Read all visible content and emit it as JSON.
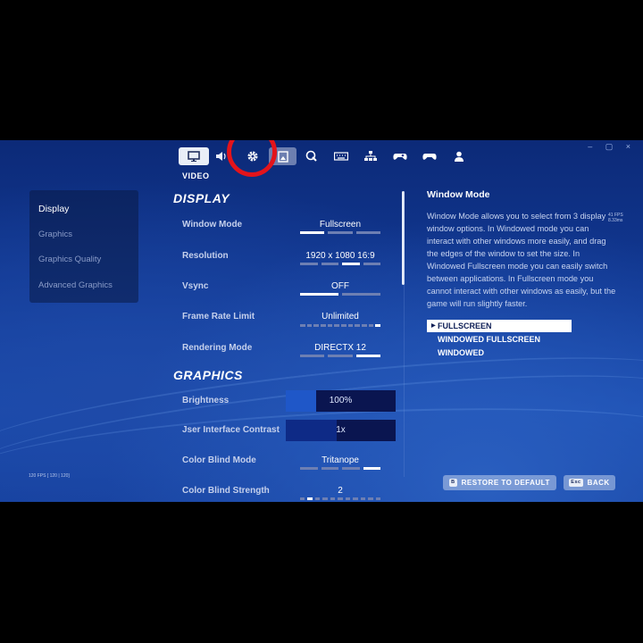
{
  "window_controls": "– ▢ ×",
  "tabs": [
    {
      "name": "video",
      "label": "VIDEO"
    },
    {
      "name": "audio"
    },
    {
      "name": "game"
    },
    {
      "name": "accessibility"
    },
    {
      "name": "touch"
    },
    {
      "name": "keyboard"
    },
    {
      "name": "network"
    },
    {
      "name": "controller-options"
    },
    {
      "name": "controller"
    },
    {
      "name": "account"
    }
  ],
  "sidebar": {
    "items": [
      "Display",
      "Graphics",
      "Graphics Quality",
      "Advanced Graphics"
    ]
  },
  "fps_counter": "120 FPS [ 120 | 120]",
  "fps_counter_right": "41 FPS\n8.33ms",
  "sections": {
    "display": "DISPLAY",
    "graphics": "GRAPHICS"
  },
  "display_settings": [
    {
      "label": "Window Mode",
      "value": "Fullscreen",
      "segments": 3,
      "active": 0
    },
    {
      "label": "Resolution",
      "value": "1920 x 1080 16:9",
      "segments": 4,
      "active": 2
    },
    {
      "label": "Vsync",
      "value": "OFF",
      "segments": 2,
      "active": 0
    },
    {
      "label": "Frame Rate Limit",
      "value": "Unlimited",
      "segments": 12,
      "active": 11
    },
    {
      "label": "Rendering Mode",
      "value": "DIRECTX 12",
      "segments": 3,
      "active": 2
    }
  ],
  "graphics_settings": {
    "brightness": {
      "label": "Brightness",
      "value": "100%",
      "level": 0.28
    },
    "ui_contrast": {
      "label": "Jser Interface Contrast",
      "value": "1x",
      "level": 0.46
    },
    "color_blind_mode": {
      "label": "Color Blind Mode",
      "value": "Tritanope",
      "segments": 4,
      "active": 3
    },
    "color_blind_strength": {
      "label": "Color Blind Strength",
      "value": "2",
      "segments": 11,
      "active": 1
    }
  },
  "help": {
    "title": "Window Mode",
    "body": "Window Mode allows you to select from 3 display window options. In Windowed mode you can interact with other windows more easily, and drag the edges of the window to set the size. In Windowed Fullscreen mode you can easily switch between applications. In Fullscreen mode you cannot interact with other windows as easily, but the game will run slightly faster.",
    "options": [
      "FULLSCREEN",
      "WINDOWED FULLSCREEN",
      "WINDOWED"
    ],
    "selected_option": 0
  },
  "footer": {
    "restore_key": "B",
    "restore_label": "RESTORE TO DEFAULT",
    "back_key": "Esc",
    "back_label": "BACK"
  },
  "colors": {
    "accent_white": "#ffffff",
    "highlight_ring": "#e3141b",
    "slider_fill": "#1f57c8"
  }
}
